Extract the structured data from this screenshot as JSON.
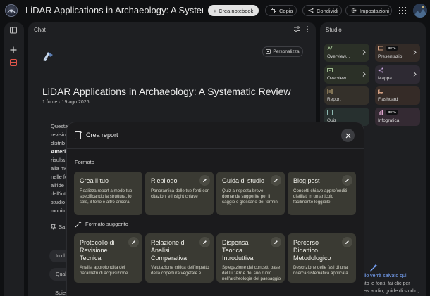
{
  "app": {
    "title": "LiDAR Applications in Archaeology: A Systematic Rev",
    "create_notebook": "Crea notebook",
    "copy": "Copia",
    "share": "Condividi",
    "settings": "Impostazioni"
  },
  "chat": {
    "header": "Chat",
    "personalize": "Personalizza",
    "notebook_title": "LiDAR Applications in Archaeology: A Systematic Review",
    "meta": "1 fonte · 19 ago 2026",
    "summary_fragments": [
      "Questa",
      "revisio",
      "distrib",
      "Ameri",
      "risulta",
      "alla mo",
      "nelle fo",
      "all'ide",
      "dell'int",
      "studio",
      "monito"
    ],
    "save_note": "Sa",
    "suggestions": [
      "In ch",
      "Quali",
      "Spieg"
    ]
  },
  "studio": {
    "header": "Studio",
    "tiles": [
      {
        "label": "Overview...",
        "icon": "audio-overview-icon",
        "color": "#2b3027",
        "beta": ""
      },
      {
        "label": "Presentazio",
        "icon": "presentation-icon",
        "color": "#332b27",
        "beta": "BETA"
      },
      {
        "label": "Overview...",
        "icon": "video-overview-icon",
        "color": "#2b3027",
        "beta": ""
      },
      {
        "label": "Mappa...",
        "icon": "mind-map-icon",
        "color": "#2e2a33",
        "beta": ""
      },
      {
        "label": "Report",
        "icon": "report-icon",
        "color": "#34302a",
        "beta": ""
      },
      {
        "label": "Flashcard",
        "icon": "flashcard-icon",
        "color": "#352b27",
        "beta": ""
      },
      {
        "label": "Quiz",
        "icon": "quiz-icon",
        "color": "#27302f",
        "beta": ""
      },
      {
        "label": "Infografica",
        "icon": "infographic-icon",
        "color": "#342a33",
        "beta": "BETA"
      }
    ],
    "note_saved": "udio verrà salvato qui.",
    "note_line2": "unto le fonti, fai clic per",
    "note_line3": "view audio, guide di studio,"
  },
  "modal": {
    "title": "Crea report",
    "section_format": "Formato",
    "section_suggested": "Formato suggerito",
    "formats": [
      {
        "title": "Crea il tuo",
        "desc": "Realizza report a modo tuo specificando la struttura, lo stile, il tono e altro ancora",
        "editable": false
      },
      {
        "title": "Riepilogo",
        "desc": "Panoramica delle tue fonti con citazioni e insight chiave",
        "editable": true
      },
      {
        "title": "Guida di studio",
        "desc": "Quiz a risposta breve, domande suggerite per il saggio e glossario dei termini",
        "editable": true
      },
      {
        "title": "Blog post",
        "desc": "Concetti chiave approfonditi distillati in un articolo facilmente leggibile",
        "editable": true
      }
    ],
    "suggested": [
      {
        "title": "Protocollo di Revisione Tecnica",
        "desc": "Analisi approfondita dei parametri di acquisizione"
      },
      {
        "title": "Relazione di Analisi Comparativa",
        "desc": "Valutazione critica dell'impatto della copertura vegetale e"
      },
      {
        "title": "Dispensa Teorica Introduttiva",
        "desc": "Spiegazione dei concetti base del LiDAR e del suo ruolo nell'archeologia del paesaggio"
      },
      {
        "title": "Percorso Didattico Metodologico",
        "desc": "Descrizione delle fasi di una ricerca sistematica applicata"
      }
    ]
  },
  "colors": {
    "card_bg": "#3a3a33",
    "modal_bg": "#1b1b1d",
    "panel_bg": "#1e1f22",
    "accent_blue": "#7aa7ff"
  }
}
